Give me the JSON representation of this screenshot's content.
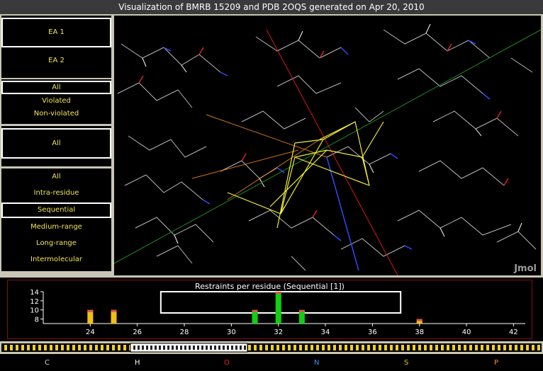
{
  "title": "Visualization of BMRB 15209 and PDB 2OQS generated on Apr 20, 2010",
  "ensembles": [
    "EA 1",
    "EA 2"
  ],
  "violation_filters": [
    "All",
    "Violated",
    "Non-violated"
  ],
  "middle_panel": {
    "label": "All"
  },
  "range_filters": [
    "All",
    "Intra-residue",
    "Sequential",
    "Medium-range",
    "Long-range",
    "Intermolecular"
  ],
  "viewer": {
    "label": "Jmol"
  },
  "colors": {
    "option_text": "#f1e454",
    "frame": "#c9c6b7",
    "chart_border": "#7a1515"
  },
  "chart_data": {
    "type": "bar",
    "title": "Restraints per residue (Sequential [1])",
    "xlim": [
      22,
      42.5
    ],
    "ylim": [
      7,
      14
    ],
    "x_ticks": [
      24,
      26,
      28,
      30,
      32,
      34,
      36,
      38,
      40,
      42
    ],
    "y_ticks": [
      8,
      10,
      12,
      14
    ],
    "bars": [
      {
        "x": 24,
        "value": 10,
        "color": "#f0c010"
      },
      {
        "x": 25,
        "value": 10,
        "color": "#f0c010"
      },
      {
        "x": 31,
        "value": 10,
        "color": "#10d010"
      },
      {
        "x": 32,
        "value": 14,
        "color": "#10d010"
      },
      {
        "x": 33,
        "value": 10,
        "color": "#10d010"
      },
      {
        "x": 38,
        "value": 8,
        "color": "#f0c010"
      }
    ],
    "highlight_range": [
      27,
      37.2
    ]
  },
  "legend": [
    {
      "label": "C",
      "color": "#cfcfcf"
    },
    {
      "label": "H",
      "color": "#ffffff"
    },
    {
      "label": "O",
      "color": "#ff2020"
    },
    {
      "label": "N",
      "color": "#3a8cff"
    },
    {
      "label": "S",
      "color": "#f0c010"
    },
    {
      "label": "P",
      "color": "#ff9020"
    }
  ]
}
